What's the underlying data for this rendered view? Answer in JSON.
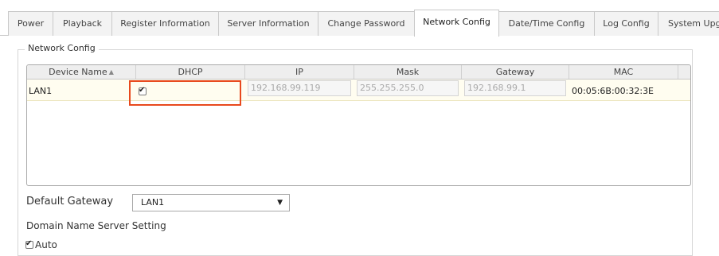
{
  "tabs": [
    {
      "label": "Power",
      "active": false
    },
    {
      "label": "Playback",
      "active": false
    },
    {
      "label": "Register Information",
      "active": false
    },
    {
      "label": "Server Information",
      "active": false
    },
    {
      "label": "Change Password",
      "active": false
    },
    {
      "label": "Network Config",
      "active": true
    },
    {
      "label": "Date/Time Config",
      "active": false
    },
    {
      "label": "Log Config",
      "active": false
    },
    {
      "label": "System Upg",
      "active": false
    }
  ],
  "network_config": {
    "legend": "Network Config",
    "table": {
      "headers": [
        "Device Name",
        "DHCP",
        "IP",
        "Mask",
        "Gateway",
        "MAC"
      ],
      "sorted_column": "Device Name",
      "rows": [
        {
          "device_name": "LAN1",
          "dhcp_checked": true,
          "ip": "192.168.99.119",
          "mask": "255.255.255.0",
          "gateway": "192.168.99.1",
          "mac": "00:05:6B:00:32:3E"
        }
      ]
    },
    "default_gateway": {
      "label": "Default Gateway",
      "value": "LAN1"
    },
    "dns": {
      "title": "Domain Name Server Setting",
      "auto_label": "Auto",
      "auto_checked": true
    }
  },
  "colors": {
    "highlight": "#e8491d",
    "row_background": "#fffdf0"
  },
  "icons": {
    "sort": "sort-arrows-icon",
    "dropdown": "caret-down-icon",
    "checkbox": "checkmark-icon"
  }
}
